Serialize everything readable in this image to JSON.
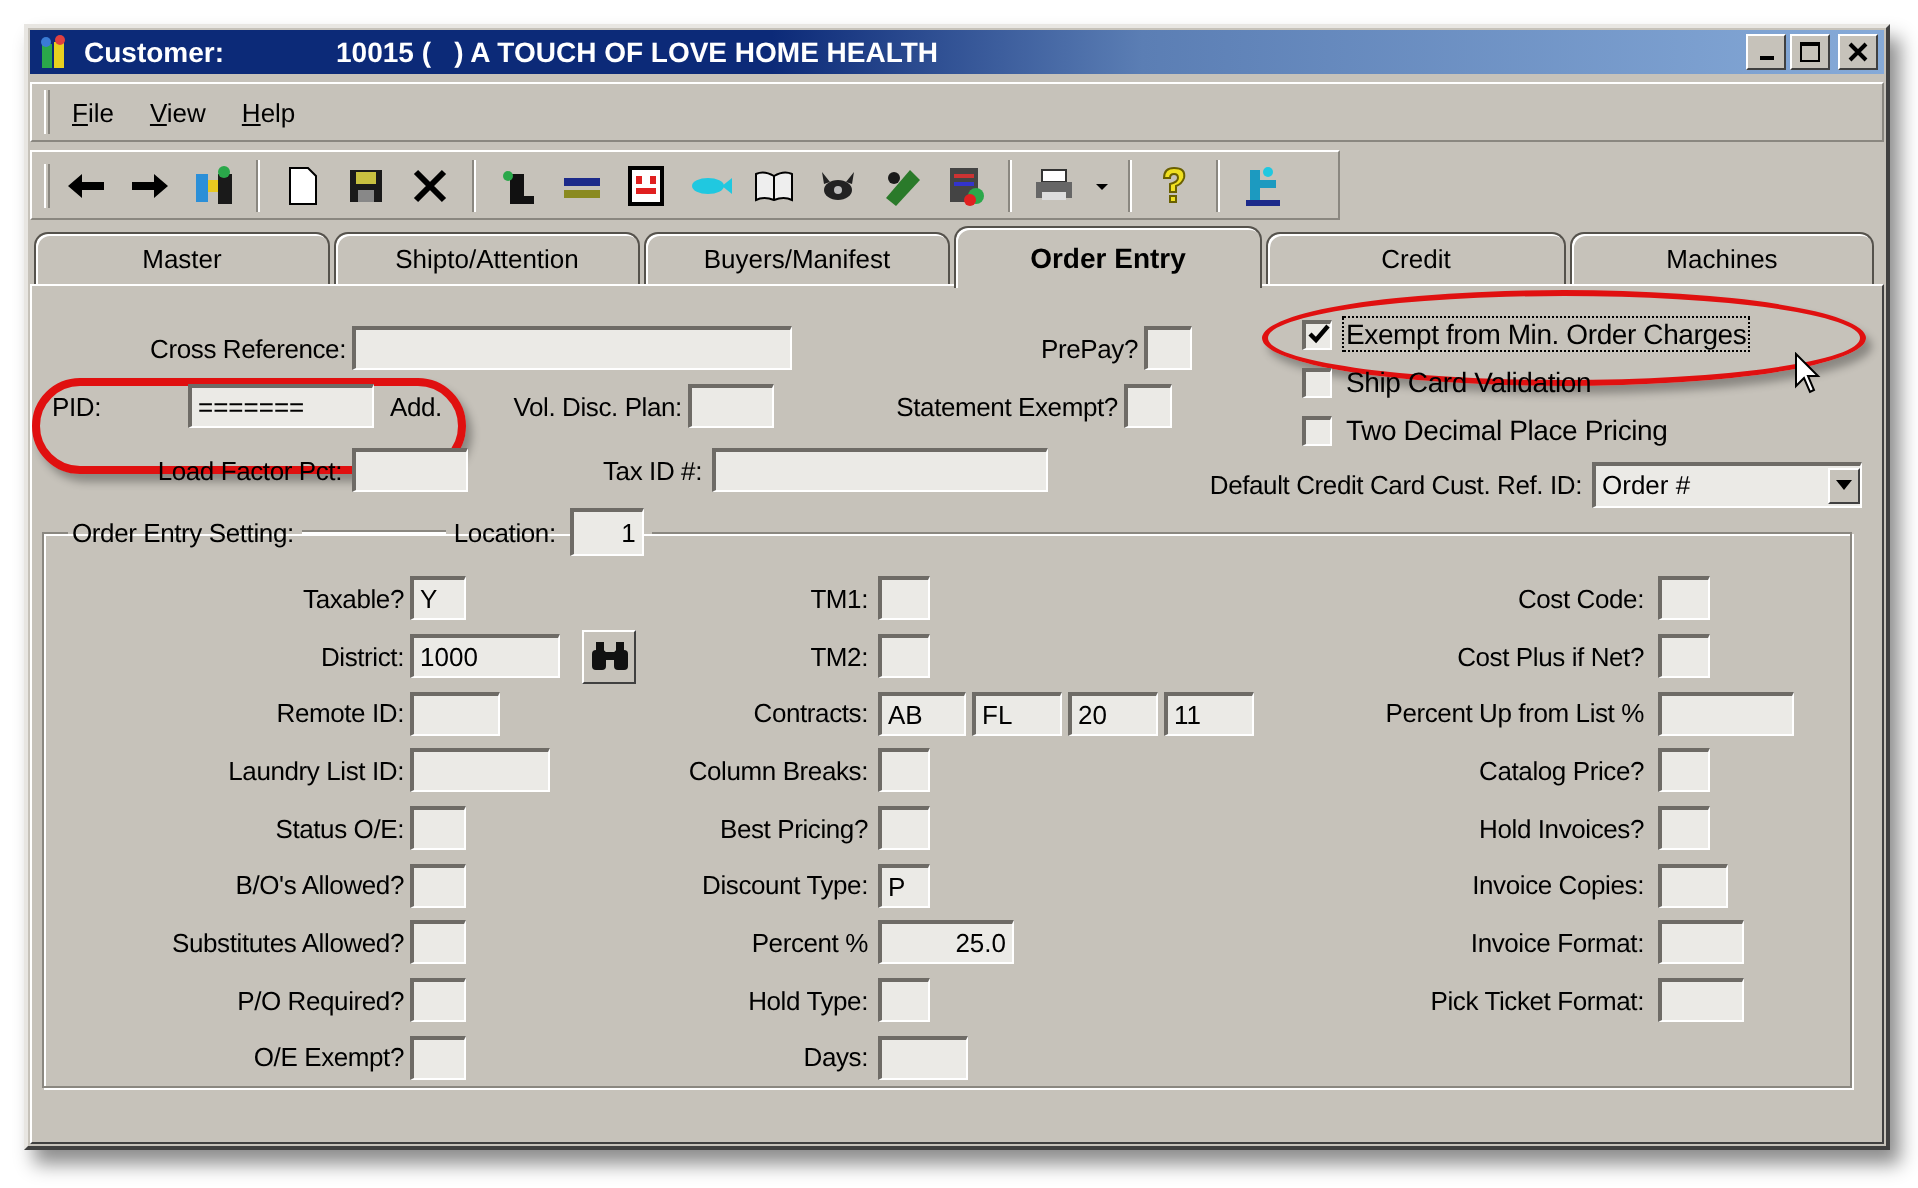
{
  "window": {
    "title_label": "Customer:",
    "title": "10015 (   ) A TOUCH OF LOVE HOME HEALTH"
  },
  "menu": [
    "File",
    "View",
    "Help"
  ],
  "tabs": [
    {
      "label": "Master",
      "selected": false
    },
    {
      "label": "Shipto/Attention",
      "selected": false
    },
    {
      "label": "Buyers/Manifest",
      "selected": false
    },
    {
      "label": "Order Entry",
      "selected": true
    },
    {
      "label": "Credit",
      "selected": false
    },
    {
      "label": "Machines",
      "selected": false
    }
  ],
  "header_fields": {
    "cross_reference": {
      "label": "Cross Reference:"
    },
    "prepay": {
      "label": "PrePay?"
    },
    "pid": {
      "label": "PID:",
      "value": "=======",
      "action": "Add."
    },
    "vol_disc_plan": {
      "label": "Vol. Disc. Plan:"
    },
    "statement_exempt": {
      "label": "Statement Exempt?"
    },
    "load_factor_pct": {
      "label": "Load Factor Pct:"
    },
    "tax_id": {
      "label": "Tax ID #:"
    },
    "default_credit_card_ref": {
      "label": "Default Credit Card Cust. Ref. ID:",
      "value": "Order #"
    }
  },
  "checkboxes": [
    {
      "label": "Exempt from Min. Order Charges",
      "checked": true,
      "focused": true
    },
    {
      "label": "Ship Card Validation",
      "checked": false,
      "focused": false
    },
    {
      "label": "Two Decimal Place Pricing",
      "checked": false,
      "focused": false
    }
  ],
  "order_entry_setting": {
    "title": "Order Entry Setting:",
    "location_label": "Location:",
    "location_value": "1",
    "columns": [
      [
        {
          "label": "Taxable?",
          "inputs": [
            {
              "value": "Y"
            }
          ]
        },
        {
          "label": "District:",
          "inputs": [
            {
              "value": "1000"
            }
          ],
          "lookup": true
        },
        {
          "label": "Remote ID:"
        },
        {
          "label": "Laundry List ID:"
        },
        {
          "label": "Status O/E:"
        },
        {
          "label": "B/O's Allowed?"
        },
        {
          "label": "Substitutes Allowed?"
        },
        {
          "label": "P/O Required?"
        },
        {
          "label": "O/E Exempt?"
        }
      ],
      [
        {
          "label": "TM1:"
        },
        {
          "label": "TM2:"
        },
        {
          "label": "Contracts:",
          "inputs": [
            {
              "value": "AB"
            },
            {
              "value": "FL"
            },
            {
              "value": "20"
            },
            {
              "value": "11"
            }
          ]
        },
        {
          "label": "Column Breaks:"
        },
        {
          "label": "Best Pricing?"
        },
        {
          "label": "Discount Type:",
          "inputs": [
            {
              "value": "P"
            }
          ]
        },
        {
          "label": "Percent %",
          "inputs": [
            {
              "value": "25.0"
            }
          ]
        },
        {
          "label": "Hold Type:"
        },
        {
          "label": "Days:"
        }
      ],
      [
        {
          "label": "Cost Code:"
        },
        {
          "label": "Cost Plus if Net?"
        },
        {
          "label": "Percent Up from List %"
        },
        {
          "label": "Catalog Price?"
        },
        {
          "label": "Hold Invoices?"
        },
        {
          "label": "Invoice Copies:"
        },
        {
          "label": "Invoice Format:"
        },
        {
          "label": "Pick Ticket Format:"
        }
      ]
    ]
  }
}
